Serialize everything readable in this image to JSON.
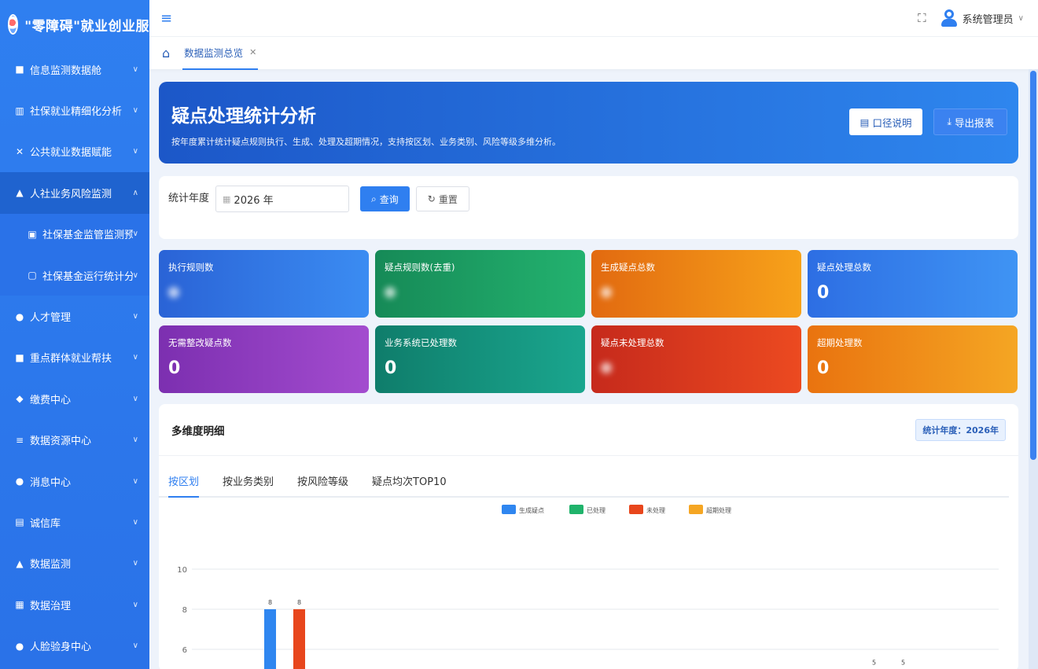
{
  "app": {
    "brand_title": "\"零障碍\"就业创业服"
  },
  "header": {
    "user_name": "系统管理员"
  },
  "tabs": [
    {
      "label": "数据监测总览"
    }
  ],
  "sidebar": {
    "items": [
      {
        "label": "信息监测数据舱",
        "icon": "file-icon"
      },
      {
        "label": "社保就业精细化分析",
        "icon": "bar-chart-icon"
      },
      {
        "label": "公共就业数据赋能",
        "icon": "tools-icon"
      },
      {
        "label": "人社业务风险监测",
        "icon": "alert-icon",
        "expanded": true
      },
      {
        "label": "社保基金监管监测预警",
        "icon": "doc-check-icon",
        "sub": true
      },
      {
        "label": "社保基金运行统计分析",
        "icon": "doc-icon",
        "sub": true
      },
      {
        "label": "人才管理",
        "icon": "person-icon"
      },
      {
        "label": "重点群体就业帮扶",
        "icon": "group-icon"
      },
      {
        "label": "缴费中心",
        "icon": "shield-icon"
      },
      {
        "label": "数据资源中心",
        "icon": "database-icon"
      },
      {
        "label": "消息中心",
        "icon": "message-icon"
      },
      {
        "label": "诚信库",
        "icon": "badge-icon"
      },
      {
        "label": "数据监测",
        "icon": "triangle-icon"
      },
      {
        "label": "数据治理",
        "icon": "grid-icon"
      },
      {
        "label": "人脸验身中心",
        "icon": "face-icon"
      }
    ]
  },
  "banner": {
    "title": "疑点处理统计分析",
    "desc": "按年度累计统计疑点规则执行、生成、处理及超期情况，支持按区划、业务类别、风险等级多维分析。",
    "btn_caliber": "口径说明",
    "btn_export": "导出报表"
  },
  "filter": {
    "label": "统计年度",
    "year_value": "2026 年",
    "btn_query": "查询",
    "btn_reset": "重置"
  },
  "cards": [
    {
      "label": "执行规则数",
      "value": "",
      "blurred": true
    },
    {
      "label": "疑点规则数(去重)",
      "value": "",
      "blurred": true
    },
    {
      "label": "生成疑点总数",
      "value": "",
      "blurred": true
    },
    {
      "label": "疑点处理总数",
      "value": "0"
    },
    {
      "label": "无需整改疑点数",
      "value": "0"
    },
    {
      "label": "业务系统已处理数",
      "value": "0"
    },
    {
      "label": "疑点未处理总数",
      "value": "",
      "blurred": true
    },
    {
      "label": "超期处理数",
      "value": "0"
    }
  ],
  "detail": {
    "title": "多维度明细",
    "year_badge": "统计年度：2026年",
    "tabs": [
      "按区划",
      "按业务类别",
      "按风险等级",
      "疑点均次TOP10"
    ]
  },
  "colors": {
    "generated": "#2f86f0",
    "processed": "#20b36b",
    "unprocessed": "#e8461c",
    "overdue": "#f5a623"
  },
  "chart_data": {
    "type": "bar",
    "legend": [
      "生成疑点",
      "已处理",
      "未处理",
      "超期处理"
    ],
    "legend_position": "top-center",
    "grid": true,
    "yticks": [
      "10",
      "8",
      "6"
    ],
    "ylim": [
      4,
      10
    ],
    "groups": [
      {
        "series": [
          {
            "name": "生成疑点",
            "value": 8,
            "label": "8"
          },
          {
            "name": "未处理",
            "value": 8,
            "label": "8"
          }
        ]
      },
      {
        "series": [
          {
            "name": "生成疑点",
            "value": 5,
            "label": "5"
          },
          {
            "name": "未处理",
            "value": 5,
            "label": "5"
          }
        ]
      }
    ]
  }
}
